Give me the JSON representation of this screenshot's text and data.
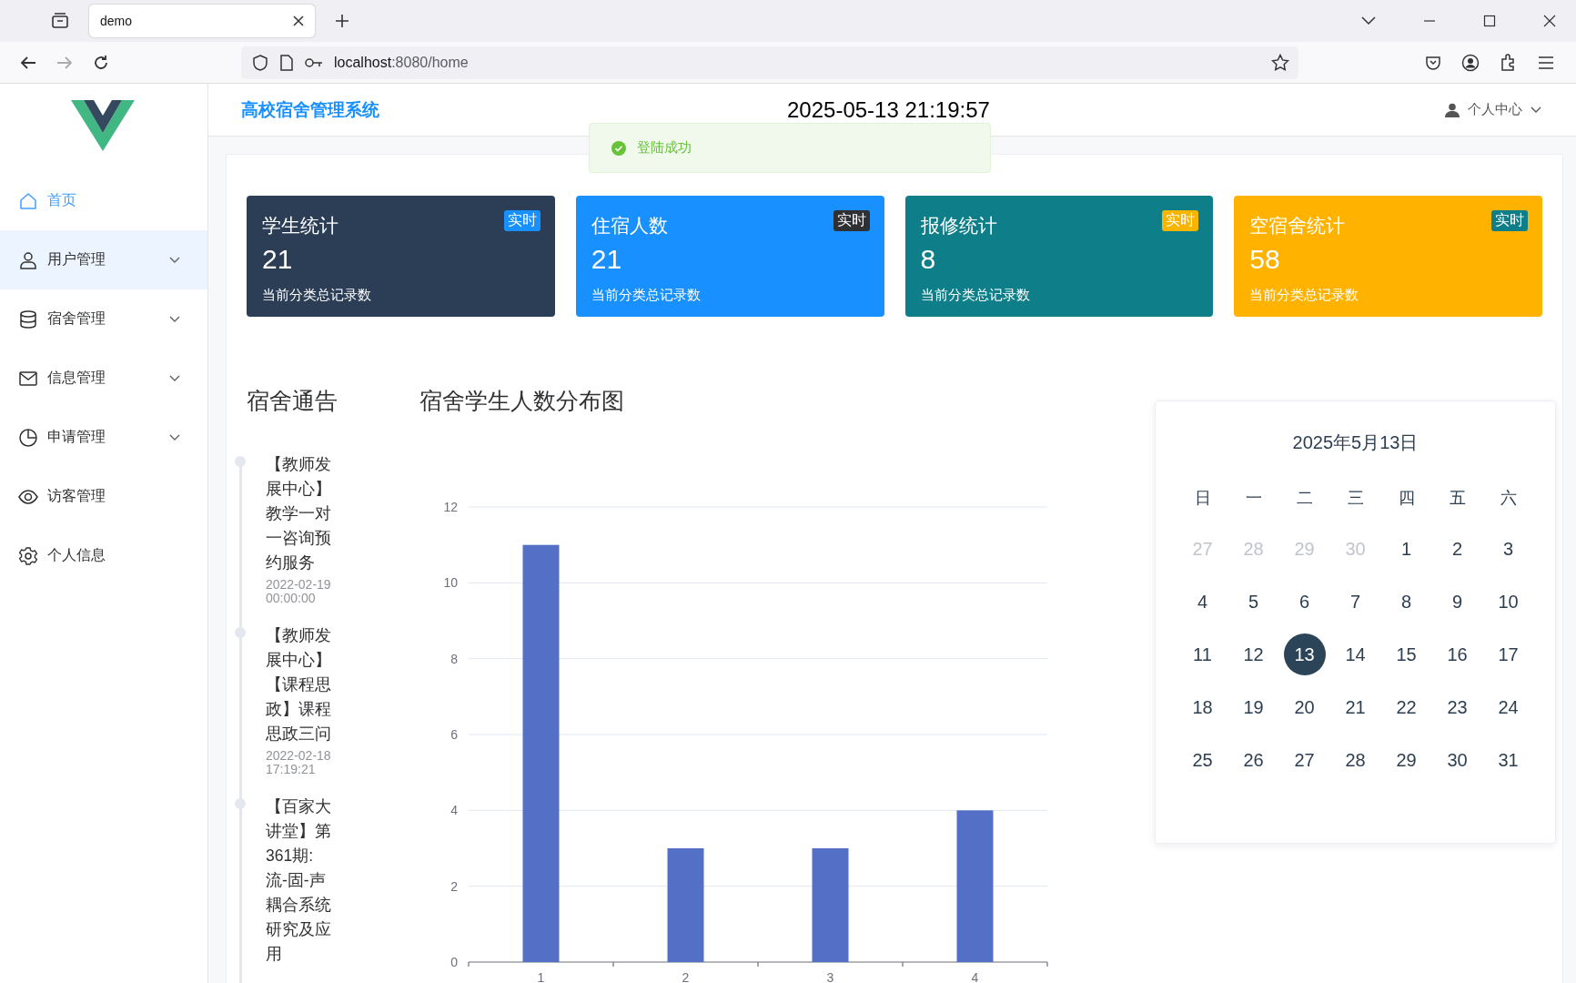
{
  "browser": {
    "tab": {
      "title": "demo"
    },
    "address": {
      "host": "localhost",
      "path": ":8080/home"
    }
  },
  "app": {
    "title": "高校宿舍管理系统",
    "clock": "2025-05-13 21:19:57",
    "user_menu": "个人中心"
  },
  "toast": {
    "message": "登陆成功"
  },
  "sidebar": {
    "items": [
      {
        "label": "首页",
        "selected": true,
        "hovered": false,
        "expandable": false
      },
      {
        "label": "用户管理",
        "selected": false,
        "hovered": true,
        "expandable": true
      },
      {
        "label": "宿舍管理",
        "selected": false,
        "hovered": false,
        "expandable": true
      },
      {
        "label": "信息管理",
        "selected": false,
        "hovered": false,
        "expandable": true
      },
      {
        "label": "申请管理",
        "selected": false,
        "hovered": false,
        "expandable": true
      },
      {
        "label": "访客管理",
        "selected": false,
        "hovered": false,
        "expandable": false
      },
      {
        "label": "个人信息",
        "selected": false,
        "hovered": false,
        "expandable": false
      }
    ]
  },
  "stats": [
    {
      "title": "学生统计",
      "value": "21",
      "caption": "当前分类总记录数",
      "badge": {
        "text": "实时",
        "color": "#1890ff"
      },
      "color": "#2c3e56"
    },
    {
      "title": "住宿人数",
      "value": "21",
      "caption": "当前分类总记录数",
      "badge": {
        "text": "实时",
        "color": "#2f3033"
      },
      "color": "#1890ff"
    },
    {
      "title": "报修统计",
      "value": "8",
      "caption": "当前分类总记录数",
      "badge": {
        "text": "实时",
        "color": "#f7b500"
      },
      "color": "#0e7f89"
    },
    {
      "title": "空宿舍统计",
      "value": "58",
      "caption": "当前分类总记录数",
      "badge": {
        "text": "实时",
        "color": "#0e7f89"
      },
      "color": "#ffb300"
    }
  ],
  "notices": {
    "title": "宿舍通告",
    "items": [
      {
        "title": "【教师发展中心】教学一对一咨询预约服务",
        "time": "2022-02-19 00:00:00"
      },
      {
        "title": "【教师发展中心】【课程思政】课程思政三问",
        "time": "2022-02-18 17:19:21"
      },
      {
        "title": "【百家大讲堂】第361期: 流-固-声耦合系统研究及应用"
      }
    ]
  },
  "chart": {
    "title": "宿舍学生人数分布图",
    "chart_data": {
      "type": "bar",
      "categories": [
        "1",
        "2",
        "3",
        "4"
      ],
      "values": [
        11,
        3,
        3,
        4
      ],
      "ylim": [
        0,
        12
      ],
      "yticks": [
        0,
        2,
        4,
        6,
        8,
        10,
        12
      ],
      "grid": true
    }
  },
  "calendar": {
    "title": "2025年5月13日",
    "weekdays": [
      "日",
      "一",
      "二",
      "三",
      "四",
      "五",
      "六"
    ],
    "days": [
      {
        "label": "27",
        "muted": true,
        "selected": false
      },
      {
        "label": "28",
        "muted": true,
        "selected": false
      },
      {
        "label": "29",
        "muted": true,
        "selected": false
      },
      {
        "label": "30",
        "muted": true,
        "selected": false
      },
      {
        "label": "1",
        "muted": false,
        "selected": false
      },
      {
        "label": "2",
        "muted": false,
        "selected": false
      },
      {
        "label": "3",
        "muted": false,
        "selected": false
      },
      {
        "label": "4",
        "muted": false,
        "selected": false
      },
      {
        "label": "5",
        "muted": false,
        "selected": false
      },
      {
        "label": "6",
        "muted": false,
        "selected": false
      },
      {
        "label": "7",
        "muted": false,
        "selected": false
      },
      {
        "label": "8",
        "muted": false,
        "selected": false
      },
      {
        "label": "9",
        "muted": false,
        "selected": false
      },
      {
        "label": "10",
        "muted": false,
        "selected": false
      },
      {
        "label": "11",
        "muted": false,
        "selected": false
      },
      {
        "label": "12",
        "muted": false,
        "selected": false
      },
      {
        "label": "13",
        "muted": false,
        "selected": true
      },
      {
        "label": "14",
        "muted": false,
        "selected": false
      },
      {
        "label": "15",
        "muted": false,
        "selected": false
      },
      {
        "label": "16",
        "muted": false,
        "selected": false
      },
      {
        "label": "17",
        "muted": false,
        "selected": false
      },
      {
        "label": "18",
        "muted": false,
        "selected": false
      },
      {
        "label": "19",
        "muted": false,
        "selected": false
      },
      {
        "label": "20",
        "muted": false,
        "selected": false
      },
      {
        "label": "21",
        "muted": false,
        "selected": false
      },
      {
        "label": "22",
        "muted": false,
        "selected": false
      },
      {
        "label": "23",
        "muted": false,
        "selected": false
      },
      {
        "label": "24",
        "muted": false,
        "selected": false
      },
      {
        "label": "25",
        "muted": false,
        "selected": false
      },
      {
        "label": "26",
        "muted": false,
        "selected": false
      },
      {
        "label": "27",
        "muted": false,
        "selected": false
      },
      {
        "label": "28",
        "muted": false,
        "selected": false
      },
      {
        "label": "29",
        "muted": false,
        "selected": false
      },
      {
        "label": "30",
        "muted": false,
        "selected": false
      },
      {
        "label": "31",
        "muted": false,
        "selected": false
      }
    ]
  }
}
